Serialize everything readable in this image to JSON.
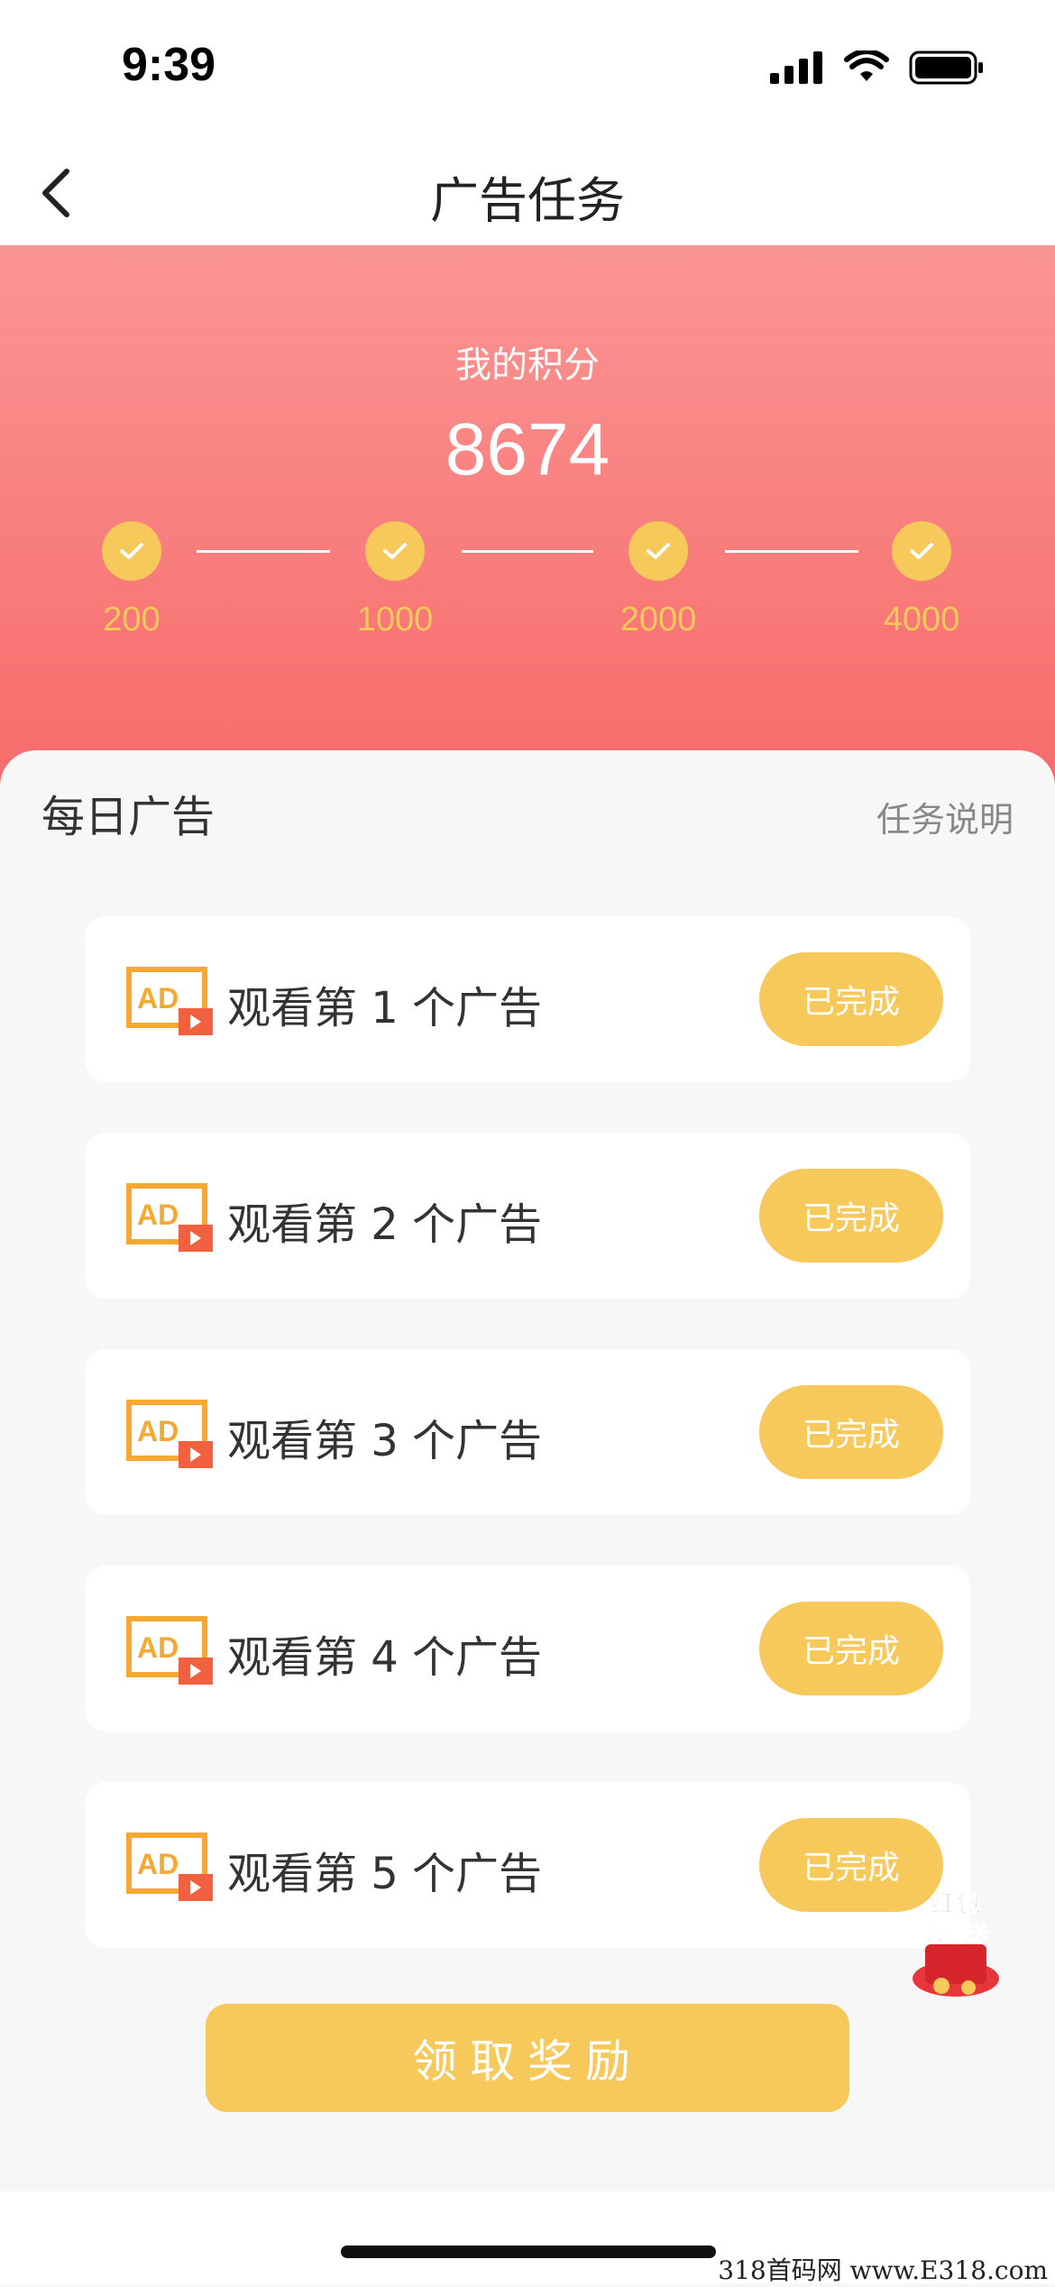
{
  "status_bar": {
    "time": "9:39"
  },
  "nav": {
    "title": "广告任务"
  },
  "header": {
    "label": "我的积分",
    "score": "8674",
    "milestones": [
      "200",
      "1000",
      "2000",
      "4000"
    ]
  },
  "panel": {
    "title": "每日广告",
    "link": "任务说明",
    "tasks": [
      {
        "label": "观看第 1 个广告",
        "button": "已完成"
      },
      {
        "label": "观看第 2 个广告",
        "button": "已完成"
      },
      {
        "label": "观看第 3 个广告",
        "button": "已完成"
      },
      {
        "label": "观看第 4 个广告",
        "button": "已完成"
      },
      {
        "label": "观看第 5 个广告",
        "button": "已完成"
      }
    ],
    "claim_button": "领取奖励"
  },
  "promo": {
    "text_line1": "红包",
    "text_line2": "大派送"
  },
  "ad_icon": {
    "text": "AD"
  },
  "watermark": "318首码网 www.E318.com",
  "colors": {
    "accent": "#f7c85a",
    "header_top": "#fa9593",
    "header_bottom": "#f76b6b"
  }
}
